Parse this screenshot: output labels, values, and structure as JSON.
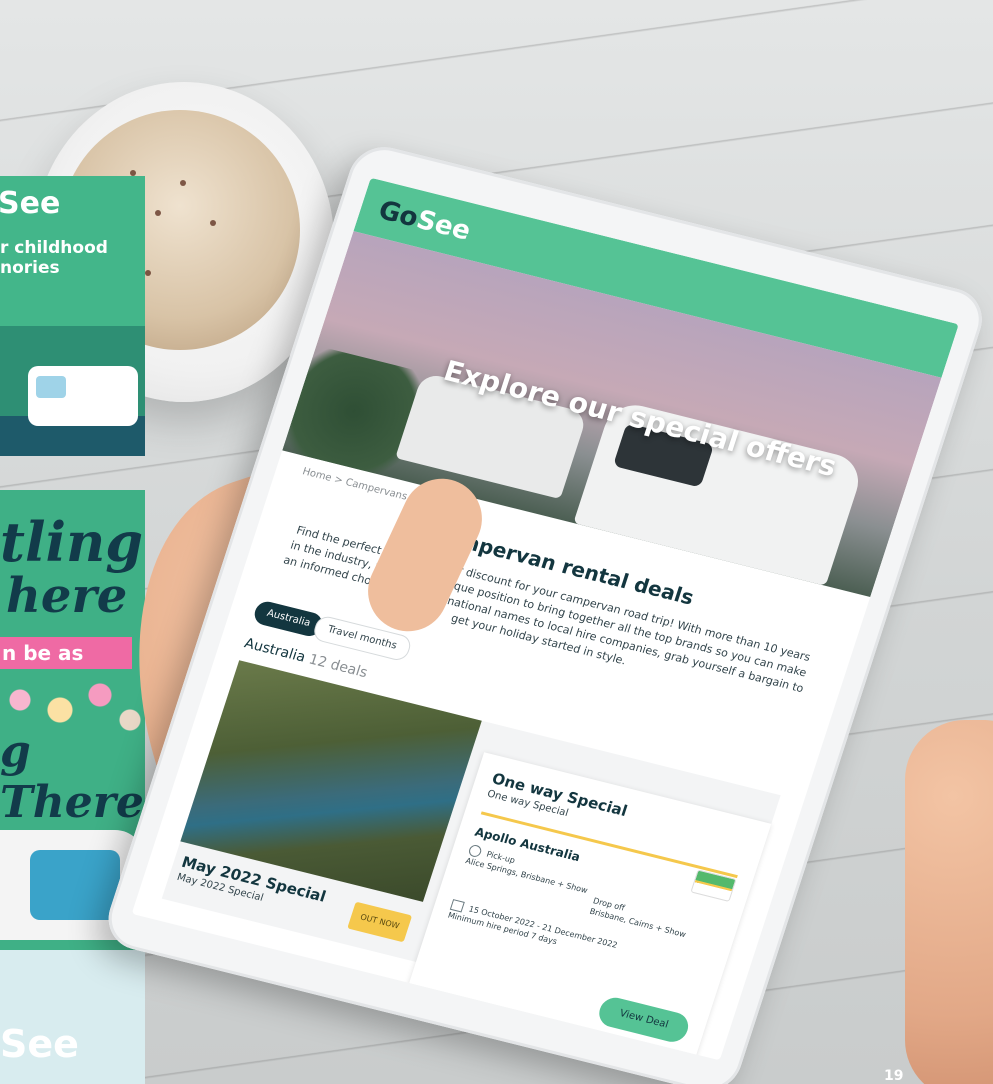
{
  "flyer_top": {
    "brand": "See",
    "headline": "r childhood\nnories"
  },
  "flyer_bottom": {
    "script_line1": "tling",
    "script_line2": "here",
    "pink_band": "n be as",
    "script_line3": "g There",
    "brand": "See"
  },
  "tablet": {
    "logo_go": "Go",
    "logo_see": "See",
    "hero_title": "Explore our special offers",
    "breadcrumb": "Home > Campervans > Deals",
    "heading": "Campervan rental deals",
    "intro": "Find the perfect promo, deal or discount for your campervan road trip! With more than 10 years in the industry, we are in a unique position to bring together all the top brands so you can make an informed choice. From international names to local hire companies, grab yourself a bargain to get your holiday started in style.",
    "tabs": [
      {
        "label": "Australia"
      },
      {
        "label": "Travel months"
      }
    ],
    "section_title": "Australia",
    "section_count": "12 deals",
    "deal": {
      "name": "May 2022 Special",
      "subtitle": "May 2022 Special",
      "badge": "OUT NOW"
    },
    "offer_panel": {
      "title": "One way Special",
      "subtitle": "One way Special",
      "brand": "Apollo Australia",
      "pickup_label": "Pick-up",
      "pickup_value": "Alice Springs, Brisbane + Show",
      "dropoff_label": "Drop off",
      "dropoff_value": "Brisbane, Cairns + Show",
      "dates": "15 October 2022 - 21 December 2022",
      "min_hire": "Minimum hire period 7 days",
      "button": "View Deal"
    }
  },
  "page_number": "19",
  "colors": {
    "brand_green": "#55c395",
    "dark_navy": "#13363f",
    "accent_yellow": "#f5c84c"
  }
}
